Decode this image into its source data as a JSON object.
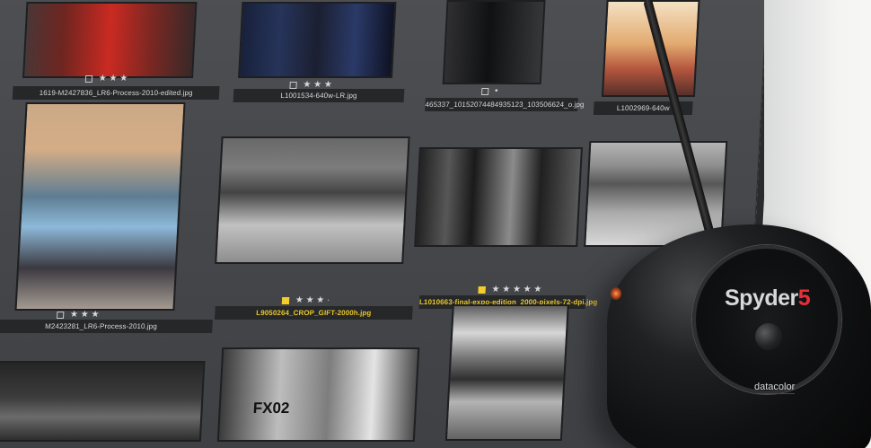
{
  "captions": {
    "c1": "1619-M2427836_LR6-Process-2010-edited.jpg",
    "c2": "L1001534-640w-LR.jpg",
    "c3": "465337_10152074484935123_103506624_o.jpg",
    "c4": "L1002969-640w",
    "c5": "M2423281_LR6-Process-2010.jpg",
    "c6": "L9050264_CROP_GIFT-2000h.jpg",
    "c7": "L1010663-final-expo-edition_2000-pixels-72-dpi.jpg"
  },
  "ratings": {
    "r1": "★ ★ ★",
    "r2": "★ ★ ★",
    "r3": "•",
    "r4": "★ ★ ★",
    "r5": "★ ★ ★ ·",
    "r6": "★ ★ ★ ★ ★"
  },
  "device": {
    "brand_word": "Spyder",
    "brand_number": "5",
    "sublogo": "datacolor"
  },
  "signage": {
    "sign_text": "FX02"
  },
  "colors": {
    "accent_yellow": "#f3ce2b",
    "brand_red": "#e92e39",
    "monitor_bg": "#45474a"
  }
}
